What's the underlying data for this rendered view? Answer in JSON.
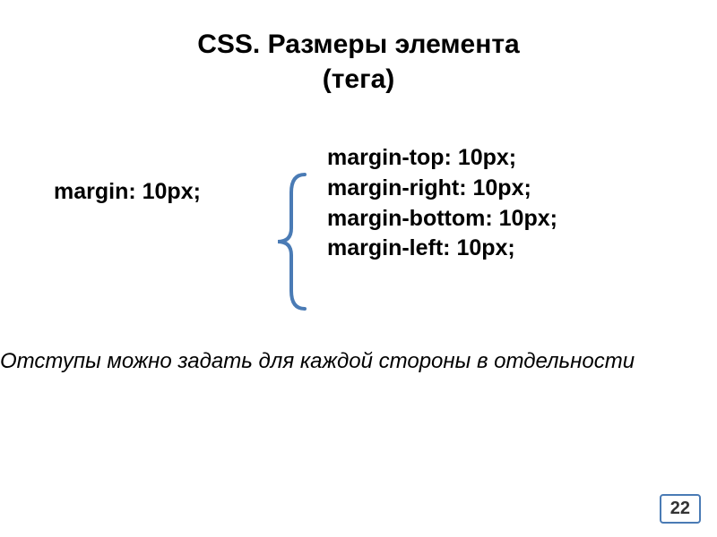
{
  "title_line1": "CSS. Размеры элемента",
  "title_line2": "(тега)",
  "shorthand": "margin: 10px;",
  "longhand": {
    "top": "margin-top: 10px;",
    "right": "margin-right: 10px;",
    "bottom": "margin-bottom: 10px;",
    "left": "margin-left: 10px;"
  },
  "caption": "Отступы можно задать для каждой стороны в отдельности",
  "page_number": "22"
}
